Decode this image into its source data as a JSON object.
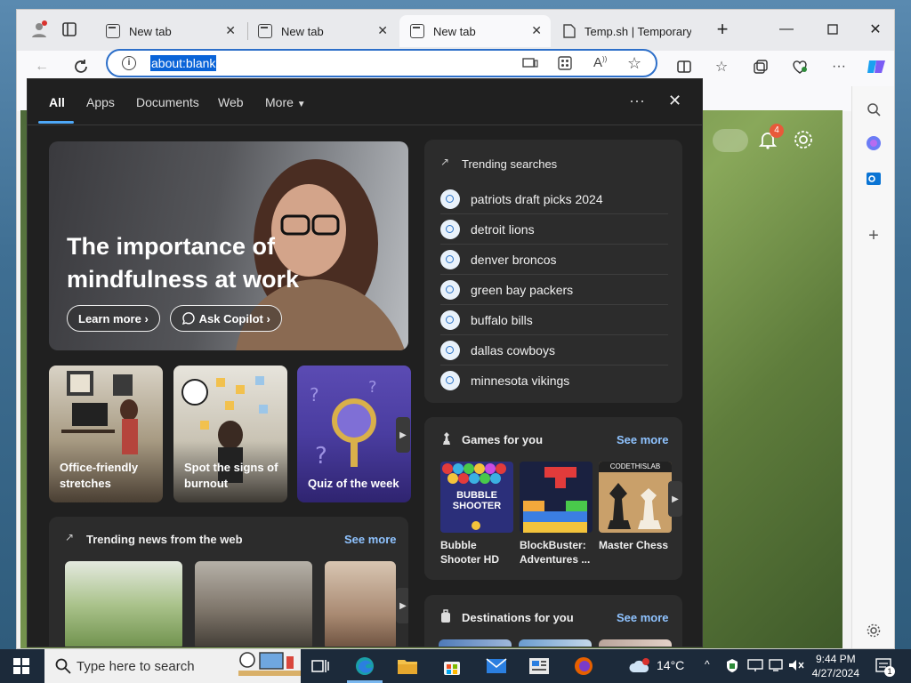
{
  "browser": {
    "tabs": [
      {
        "label": "New tab",
        "active": false
      },
      {
        "label": "New tab",
        "active": false
      },
      {
        "label": "New tab",
        "active": true
      },
      {
        "label": "Temp.sh | Temporary",
        "active": false
      }
    ],
    "address": "about:blank",
    "sidebar_badge": "4"
  },
  "panel": {
    "tabs": [
      "All",
      "Apps",
      "Documents",
      "Web",
      "More"
    ],
    "hero": {
      "title": "The importance of mindfulness at work",
      "learn_more": "Learn more",
      "ask_copilot": "Ask Copilot"
    },
    "cards": [
      {
        "label": "Office-friendly stretches"
      },
      {
        "label": "Spot the signs of burnout"
      },
      {
        "label": "Quiz of the week"
      }
    ],
    "news": {
      "title": "Trending news from the web",
      "see_more": "See more"
    },
    "trending": {
      "title": "Trending searches",
      "items": [
        "patriots draft picks 2024",
        "detroit lions",
        "denver broncos",
        "green bay packers",
        "buffalo bills",
        "dallas cowboys",
        "minnesota vikings"
      ]
    },
    "games": {
      "title": "Games for you",
      "see_more": "See more",
      "items": [
        {
          "label": "Bubble Shooter HD",
          "art": "BUBBLE SHOOTER"
        },
        {
          "label": "BlockBuster: Adventures ...",
          "art": ""
        },
        {
          "label": "Master Chess",
          "art": "CODETHISLAB"
        }
      ]
    },
    "destinations": {
      "title": "Destinations for you",
      "see_more": "See more"
    }
  },
  "taskbar": {
    "search_placeholder": "Type here to search",
    "temperature": "14°C",
    "time": "9:44 PM",
    "date": "4/27/2024",
    "notification_count": "1"
  },
  "colors": {
    "panel_bg": "#202020",
    "card_bg": "#2c2c2c",
    "accent": "#4ea8f7",
    "link": "#8fc3ff",
    "address_border": "#2d6fc9"
  }
}
